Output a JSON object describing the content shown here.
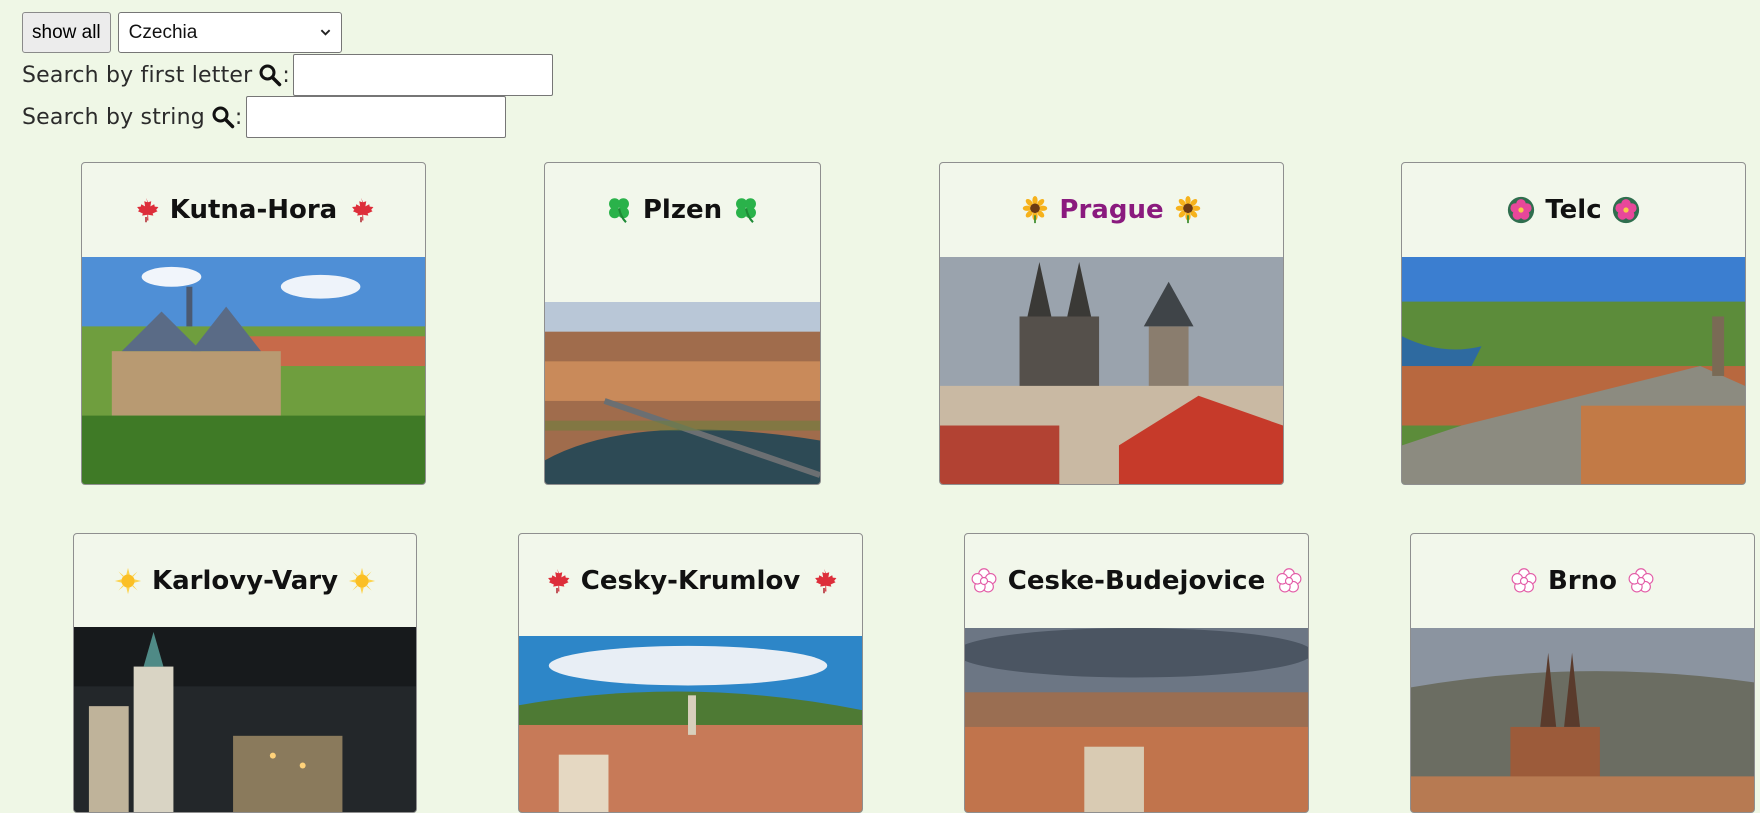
{
  "controls": {
    "show_all_label": "show all",
    "country_selected": "Czechia",
    "search_first_letter_label": "Search by first letter",
    "search_string_label": "Search by string",
    "colon": ":"
  },
  "cities": [
    {
      "name": "Kutna-Hora",
      "icon": "maple-leaf-icon"
    },
    {
      "name": "Plzen",
      "icon": "four-leaf-clover-icon"
    },
    {
      "name": "Prague",
      "icon": "sunflower-icon"
    },
    {
      "name": "Telc",
      "icon": "hibiscus-icon"
    },
    {
      "name": "Karlovy-Vary",
      "icon": "sun-icon"
    },
    {
      "name": "Cesky-Krumlov",
      "icon": "maple-leaf-icon"
    },
    {
      "name": "Ceske-Budejovice",
      "icon": "white-flower-icon"
    },
    {
      "name": "Brno",
      "icon": "white-flower-icon"
    }
  ],
  "colors": {
    "background": "#eff7e6",
    "highlight_title": "#8a1a7e"
  }
}
